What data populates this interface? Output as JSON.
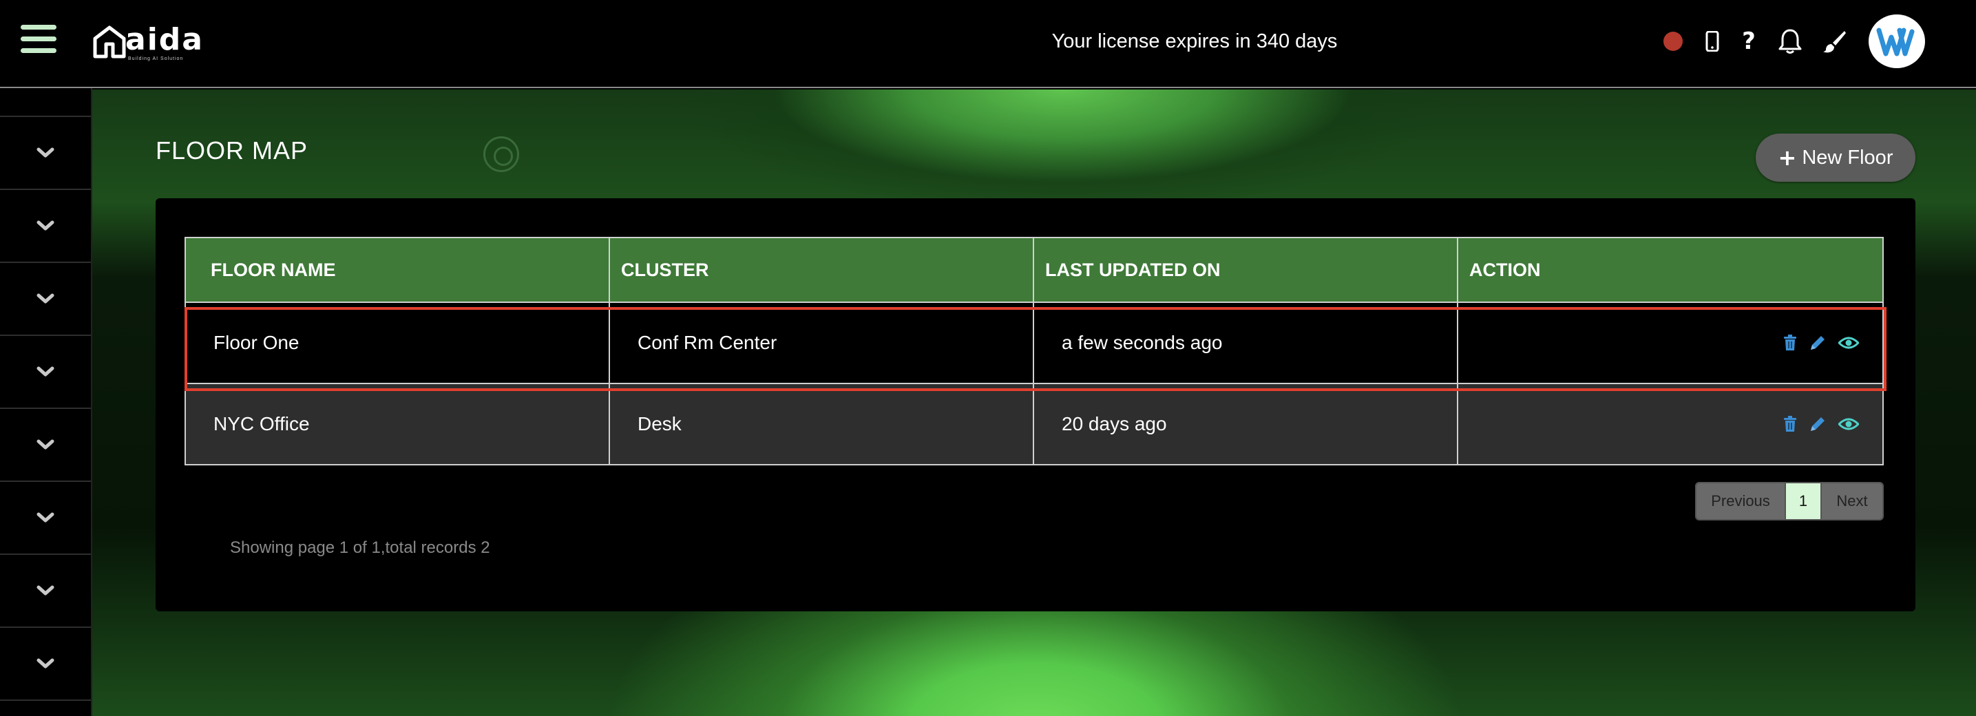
{
  "header": {
    "logo_text": "aida",
    "logo_tagline": "Building AI Solution",
    "license_text": "Your license expires in 340 days",
    "icons": [
      "recording-dot-icon",
      "mobile-phone-icon",
      "help-icon",
      "bell-icon",
      "paint-brush-icon"
    ],
    "avatar_letter": "W",
    "colors": {
      "record_dot": "#b5392d",
      "hamburger": "#c7ecc9"
    }
  },
  "sidebar": {
    "items": [
      {
        "icon": "chevron-down-icon"
      },
      {
        "icon": "chevron-down-icon"
      },
      {
        "icon": "chevron-down-icon"
      },
      {
        "icon": "chevron-down-icon"
      },
      {
        "icon": "chevron-down-icon"
      },
      {
        "icon": "chevron-down-icon"
      },
      {
        "icon": "chevron-down-icon"
      },
      {
        "icon": "chevron-down-icon"
      }
    ]
  },
  "page": {
    "title": "FLOOR MAP",
    "new_button_label": "New Floor"
  },
  "table": {
    "headers": [
      "FLOOR NAME",
      "CLUSTER",
      "LAST UPDATED ON",
      "ACTION"
    ],
    "rows": [
      {
        "floor_name": "Floor One",
        "cluster": "Conf Rm Center",
        "last_updated": "a few seconds ago",
        "highlighted": true
      },
      {
        "floor_name": "NYC Office",
        "cluster": "Desk",
        "last_updated": "20 days ago",
        "highlighted": false
      }
    ],
    "row_actions": [
      "trash-icon",
      "pencil-icon",
      "eye-icon"
    ],
    "header_color": "#3f7a38",
    "highlight_color": "#e0402e"
  },
  "pagination": {
    "previous_label": "Previous",
    "current_page": "1",
    "next_label": "Next",
    "summary": "Showing page 1 of 1,total records 2"
  }
}
